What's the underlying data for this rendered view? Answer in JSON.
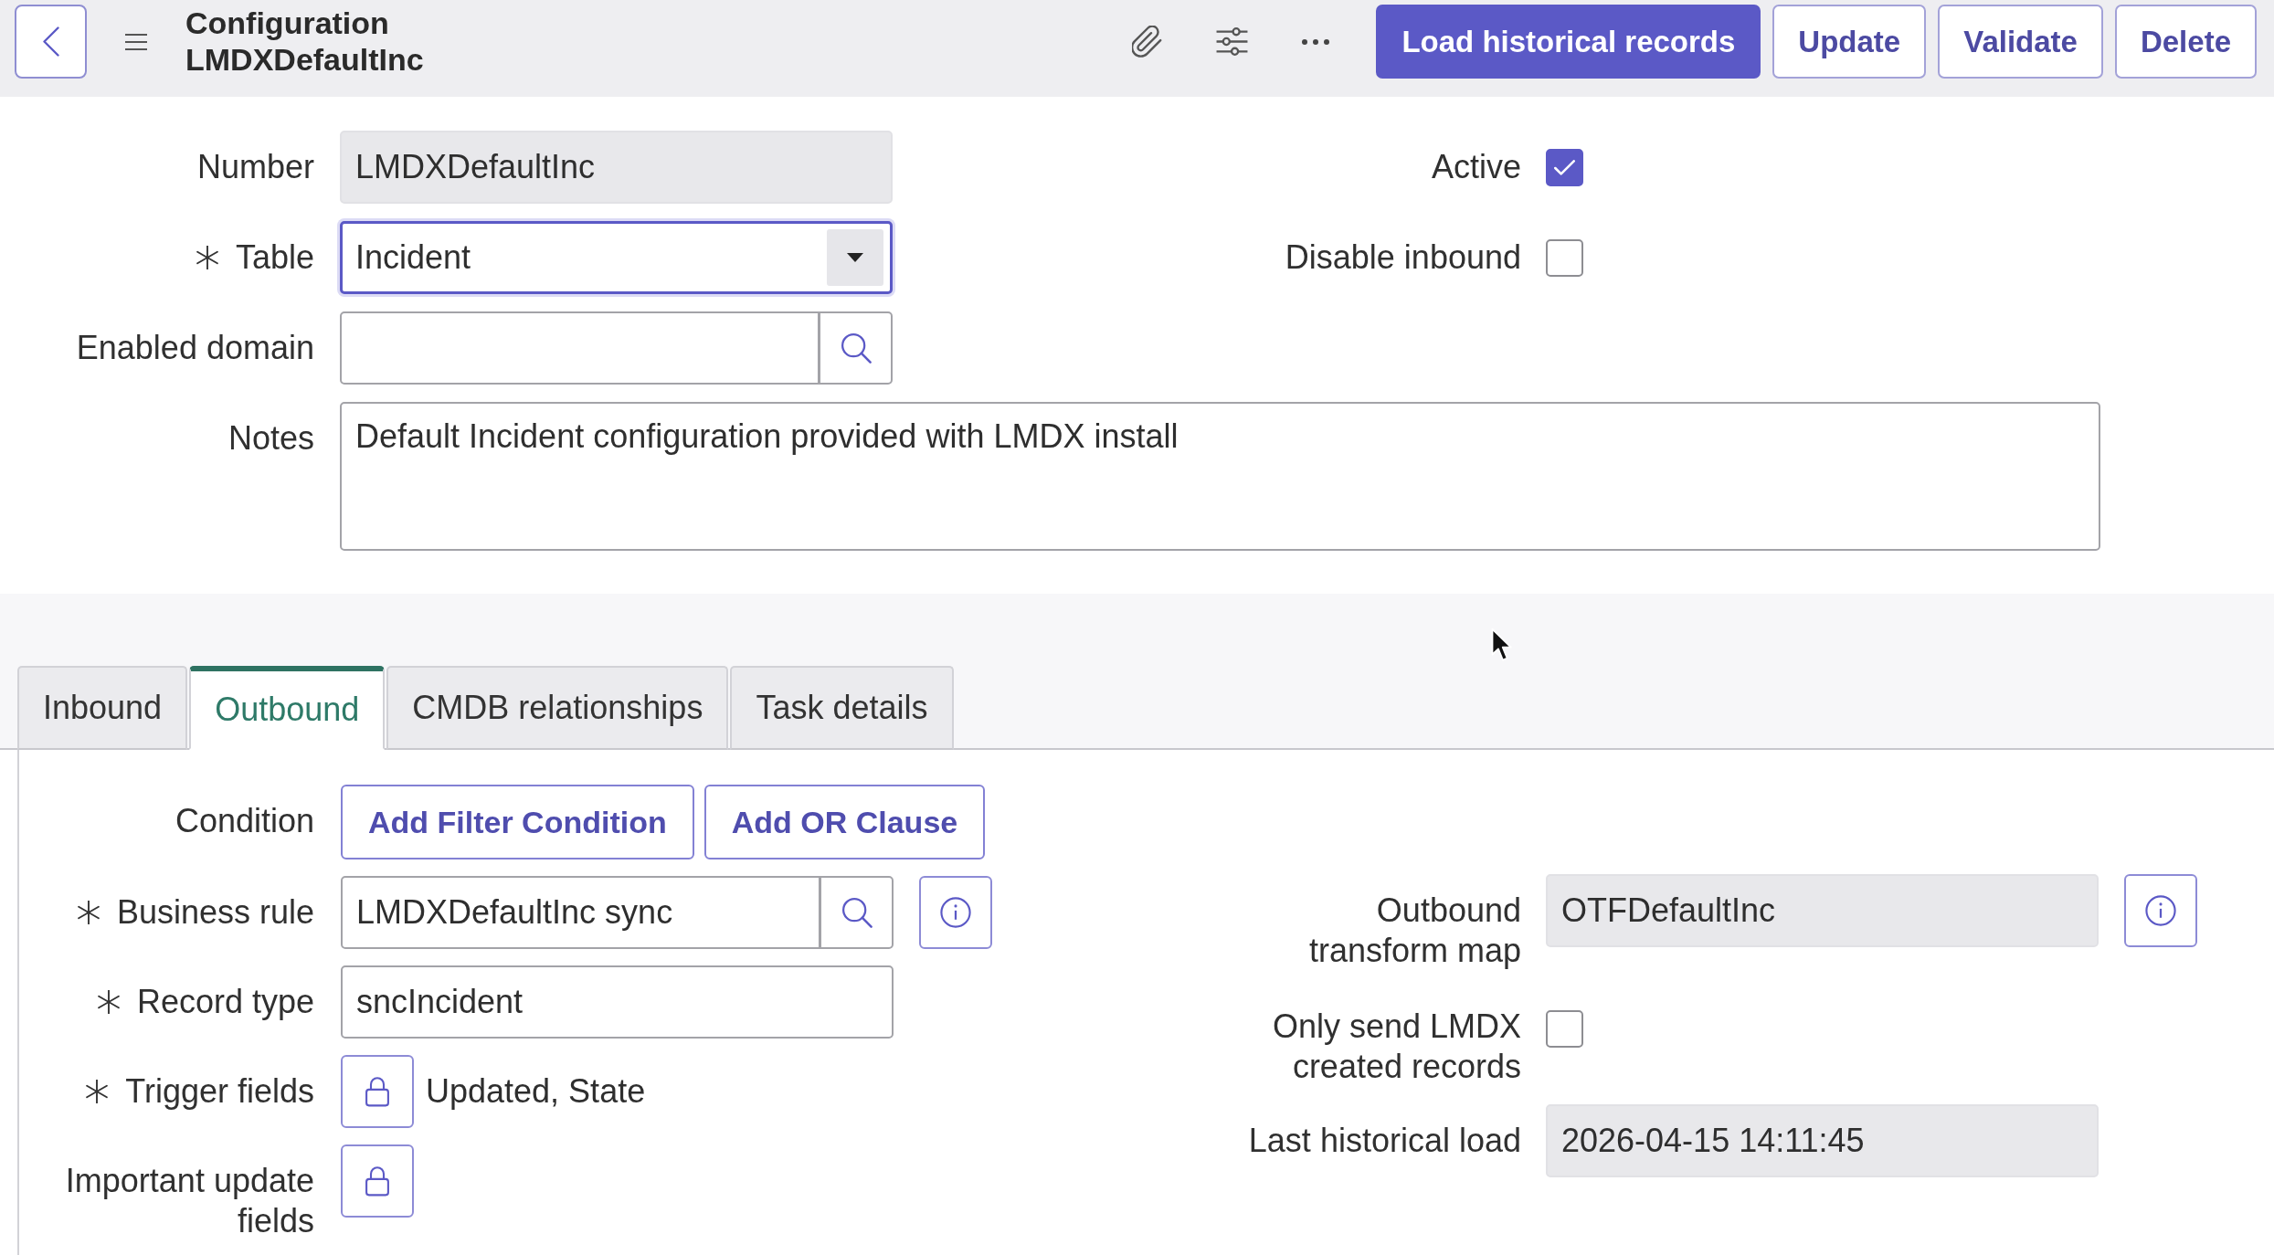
{
  "header": {
    "title": "Configuration",
    "subtitle": "LMDXDefaultInc",
    "actions": [
      {
        "label": "Load historical records",
        "kind": "primary"
      },
      {
        "label": "Update",
        "kind": "secondary"
      },
      {
        "label": "Validate",
        "kind": "secondary"
      },
      {
        "label": "Delete",
        "kind": "secondary"
      }
    ]
  },
  "form": {
    "fields": [
      {
        "kind": "readonly",
        "label": "Number",
        "required": false,
        "focused": false,
        "value": "LMDXDefaultInc"
      },
      {
        "kind": "select",
        "label": "Table",
        "required": true,
        "focused": true,
        "value": "Incident"
      },
      {
        "kind": "reference",
        "label": "Enabled domain",
        "required": false,
        "focused": false
      }
    ],
    "options": [
      {
        "label": "Active",
        "checked": true
      },
      {
        "label": "Disable inbound",
        "checked": false
      }
    ],
    "notes": {
      "label": "Notes",
      "value": "Default Incident configuration provided with LMDX install"
    }
  },
  "tabs": [
    {
      "label": "Inbound",
      "selected": false
    },
    {
      "label": "Outbound",
      "selected": true
    },
    {
      "label": "CMDB relationships",
      "selected": false
    },
    {
      "label": "Task details",
      "selected": false
    }
  ],
  "outbound": {
    "fields": [
      {
        "kind": "condition",
        "label": "Condition",
        "required": false,
        "buttons": [
          "Add Filter Condition",
          "Add OR Clause"
        ]
      },
      {
        "kind": "reference",
        "label": "Business rule",
        "required": true,
        "value": "LMDXDefaultInc sync",
        "info": true
      },
      {
        "kind": "text",
        "label": "Record type",
        "required": true,
        "value": "sncIncident",
        "info": false
      },
      {
        "kind": "locked_list",
        "label": "Trigger fields",
        "required": true,
        "value": "Updated, State"
      },
      {
        "kind": "locked_list",
        "label": "Important update fields",
        "required": false
      }
    ],
    "settings": [
      {
        "kind": "readonly",
        "label": "Outbound transform map",
        "required": false,
        "value": "OTFDefaultInc",
        "info": true
      },
      {
        "kind": "checkbox",
        "label": "Only send LMDX created records",
        "required": false,
        "checked": false
      },
      {
        "kind": "readonly",
        "label": "Last historical load",
        "required": false,
        "value": "2026-04-15 14:11:45",
        "info": false
      }
    ]
  }
}
